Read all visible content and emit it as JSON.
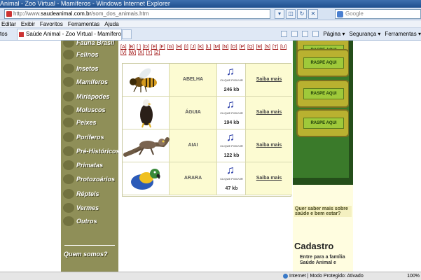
{
  "window": {
    "title": "Animal - Zoo Virtual - Mamíferos - Windows Internet Explorer"
  },
  "address": {
    "prefix": "http://www.",
    "domain": "saudeanimal.com.br",
    "path": "/som_dos_animais.htm"
  },
  "search": {
    "placeholder": "Google"
  },
  "menu": [
    "Editar",
    "Exibir",
    "Favoritos",
    "Ferramentas",
    "Ajuda"
  ],
  "tabs": {
    "favorites_label": "tos",
    "active_tab": "Saúde Animal - Zoo Virtual - Mamíferos"
  },
  "commandbar": {
    "page": "Página ▾",
    "security": "Segurança ▾",
    "tools": "Ferramentas ▾"
  },
  "sidebar": {
    "items": [
      {
        "label": "Fauna Brasil"
      },
      {
        "label": "Felinos"
      },
      {
        "label": "Insetos"
      },
      {
        "label": "Mamíferos"
      },
      {
        "label": "Miriápodes"
      },
      {
        "label": "Moluscos"
      },
      {
        "label": "Peixes"
      },
      {
        "label": "Poríferos"
      },
      {
        "label": "Pré-Históricos"
      },
      {
        "label": "Primatas"
      },
      {
        "label": "Protozoários"
      },
      {
        "label": "Répteis"
      },
      {
        "label": "Vermes"
      },
      {
        "label": "Outros"
      }
    ],
    "bottom": {
      "label": "Quem somos?"
    }
  },
  "alphabet": [
    "[A]",
    "[B]",
    "[ ]",
    "[D]",
    "[E]",
    "[F]",
    "[G]",
    "[H]",
    "[I]",
    "[J]",
    "[K]",
    "[L]",
    "[M]",
    "[N]",
    "[O]",
    "[P]",
    "[Q]",
    "[R]",
    "[S]",
    "[T]",
    "[U]",
    "[V]",
    "[W]",
    "[X]",
    "[Y]",
    "[Z]"
  ],
  "animals": [
    {
      "name": "ABELHA",
      "size": "246 kb",
      "more": "Saiba mais",
      "clique": "CLIQUE P/OUVIR"
    },
    {
      "name": "ÁGUIA",
      "size": "194 kb",
      "more": "Saiba mais",
      "clique": "CLIQUE P/OUVIR"
    },
    {
      "name": "AIAI",
      "size": "122 kb",
      "more": "Saiba mais",
      "clique": "CLIQUE P/OUVIR"
    },
    {
      "name": "ARARA",
      "size": "47 kb",
      "more": "Saiba mais",
      "clique": "CLIQUE P/OUVIR"
    }
  ],
  "ads": {
    "button": "RASPE AQUI"
  },
  "cadastro": {
    "question": "Quer saber mais sobre saúde e bem estar?",
    "title": "Cadastro",
    "text": "Entre para a família Saúde Animal e"
  },
  "status": {
    "zone": "Internet | Modo Protegido: Ativado",
    "zoom": "100%"
  }
}
